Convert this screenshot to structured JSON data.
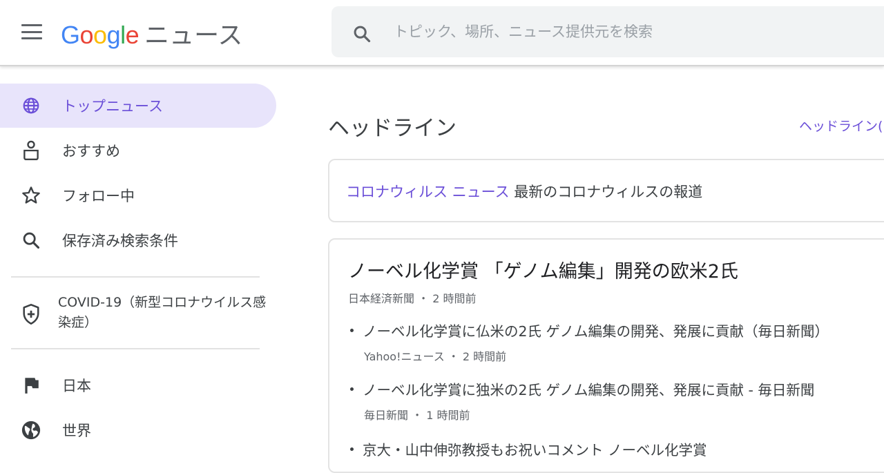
{
  "header": {
    "logo_brand": "Google",
    "logo_product": "ニュース",
    "search_placeholder": "トピック、場所、ニュース提供元を検索"
  },
  "sidebar": {
    "items": [
      {
        "label": "トップニュース",
        "icon": "globe-icon",
        "active": true
      },
      {
        "label": "おすすめ",
        "icon": "person-icon"
      },
      {
        "label": "フォロー中",
        "icon": "star-icon"
      },
      {
        "label": "保存済み検索条件",
        "icon": "search-icon"
      }
    ],
    "covid": {
      "label": "COVID-19（新型コロナウイルス感染症）",
      "icon": "shield-plus-icon"
    },
    "regions": [
      {
        "label": "日本",
        "icon": "flag-icon"
      },
      {
        "label": "世界",
        "icon": "world-icon"
      }
    ]
  },
  "main": {
    "section_title": "ヘッドライン",
    "section_link": "ヘッドライン(",
    "covid_banner": {
      "link": "コロナウィルス ニュース",
      "text": " 最新のコロナウィルスの報道"
    },
    "story": {
      "title": "ノーベル化学賞 「ゲノム編集」開発の欧米2氏",
      "source": "日本経済新聞",
      "time": "2 時間前",
      "related": [
        {
          "title": "ノーベル化学賞に仏米の2氏 ゲノム編集の開発、発展に貢献（毎日新聞）",
          "source": "Yahoo!ニュース",
          "time": "2 時間前"
        },
        {
          "title": "ノーベル化学賞に独米の2氏 ゲノム編集の開発、発展に貢献 - 毎日新聞",
          "source": "毎日新聞",
          "time": "1 時間前"
        },
        {
          "title": "京大・山中伸弥教授もお祝いコメント ノーベル化学賞",
          "source": "",
          "time": ""
        }
      ]
    }
  },
  "colors": {
    "accent": "#6b4fd8",
    "active_bg": "#e8e4fb",
    "search_bg": "#f1f3f4"
  }
}
